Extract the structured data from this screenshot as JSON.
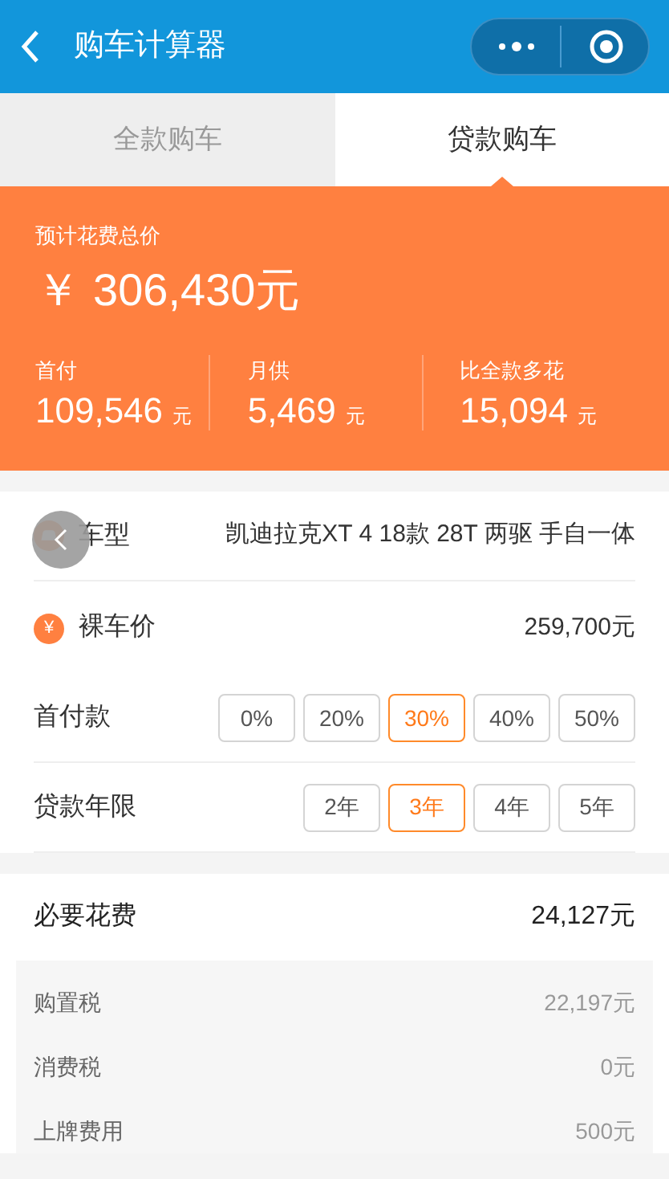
{
  "header": {
    "title": "购车计算器"
  },
  "tabs": [
    {
      "label": "全款购车",
      "selected": false
    },
    {
      "label": "贷款购车",
      "selected": true
    }
  ],
  "summary": {
    "label": "预计花费总价",
    "currency": "￥",
    "total": "306,430元",
    "stats": [
      {
        "label": "首付",
        "value": "109,546",
        "unit": "元"
      },
      {
        "label": "月供",
        "value": "5,469",
        "unit": "元"
      },
      {
        "label": "比全款多花",
        "value": "15,094",
        "unit": "元"
      }
    ]
  },
  "car": {
    "label": "车型",
    "value": "凯迪拉克XT 4 18款 28T 两驱 手自一体"
  },
  "price": {
    "icon": "¥",
    "label": "裸车价",
    "value": "259,700元"
  },
  "down_payment": {
    "label": "首付款",
    "options": [
      {
        "label": "0%",
        "selected": false
      },
      {
        "label": "20%",
        "selected": false
      },
      {
        "label": "30%",
        "selected": true
      },
      {
        "label": "40%",
        "selected": false
      },
      {
        "label": "50%",
        "selected": false
      }
    ]
  },
  "loan_term": {
    "label": "贷款年限",
    "options": [
      {
        "label": "2年",
        "selected": false
      },
      {
        "label": "3年",
        "selected": true
      },
      {
        "label": "4年",
        "selected": false
      },
      {
        "label": "5年",
        "selected": false
      }
    ]
  },
  "fees": {
    "label": "必要花费",
    "value": "24,127元",
    "items": [
      {
        "label": "购置税",
        "value": "22,197元"
      },
      {
        "label": "消费税",
        "value": "0元"
      },
      {
        "label": "上牌费用",
        "value": "500元"
      }
    ]
  }
}
